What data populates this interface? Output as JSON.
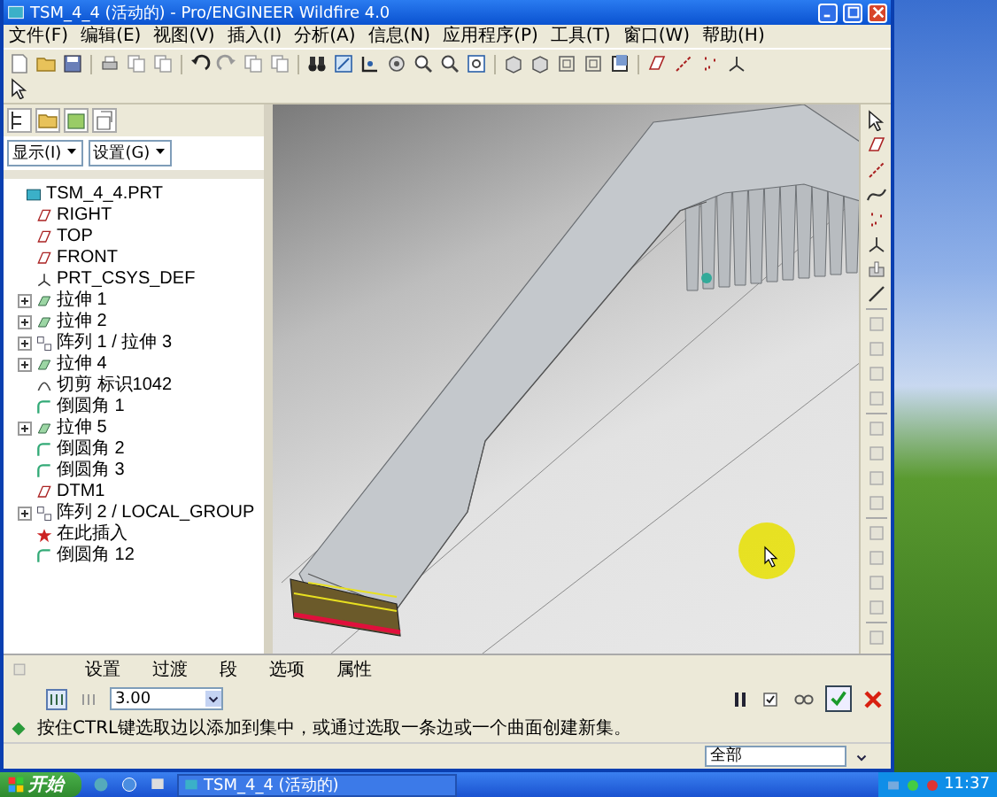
{
  "window": {
    "title": "TSM_4_4 (活动的) - Pro/ENGINEER Wildfire 4.0"
  },
  "menu": [
    "文件(F)",
    "编辑(E)",
    "视图(V)",
    "插入(I)",
    "分析(A)",
    "信息(N)",
    "应用程序(P)",
    "工具(T)",
    "窗口(W)",
    "帮助(H)"
  ],
  "navigator": {
    "dropdowns": [
      "显示(I)",
      "设置(G)"
    ]
  },
  "model_tree": {
    "label": "TSM_4_4.PRT",
    "kind": "part",
    "collapsed": false,
    "children": [
      {
        "label": "RIGHT",
        "kind": "plane",
        "collapsed": false
      },
      {
        "label": "TOP",
        "kind": "plane",
        "collapsed": false
      },
      {
        "label": "FRONT",
        "kind": "plane",
        "collapsed": false
      },
      {
        "label": "PRT_CSYS_DEF",
        "kind": "csys",
        "collapsed": false
      },
      {
        "label": "拉伸 1",
        "kind": "extrude",
        "collapsed": true
      },
      {
        "label": "拉伸 2",
        "kind": "extrude",
        "collapsed": true
      },
      {
        "label": "阵列 1 / 拉伸 3",
        "kind": "pattern",
        "collapsed": true
      },
      {
        "label": "拉伸 4",
        "kind": "extrude",
        "collapsed": true
      },
      {
        "label": "切剪 标识1042",
        "kind": "cut",
        "collapsed": false
      },
      {
        "label": "倒圆角 1",
        "kind": "round",
        "collapsed": false
      },
      {
        "label": "拉伸 5",
        "kind": "extrude",
        "collapsed": true
      },
      {
        "label": "倒圆角 2",
        "kind": "round",
        "collapsed": false
      },
      {
        "label": "倒圆角 3",
        "kind": "round",
        "collapsed": false
      },
      {
        "label": "DTM1",
        "kind": "plane",
        "collapsed": false
      },
      {
        "label": "阵列 2 / LOCAL_GROUP",
        "kind": "pattern",
        "collapsed": true
      },
      {
        "label": "在此插入",
        "kind": "insert",
        "collapsed": false
      },
      {
        "label": "倒圆角 12",
        "kind": "round",
        "collapsed": false
      }
    ]
  },
  "dashboard": {
    "tabs": [
      "设置",
      "过渡",
      "段",
      "选项",
      "属性"
    ],
    "radius": {
      "value": "3.00"
    },
    "message": "按住CTRL键选取边以添加到集中，或通过选取一条边或一个曲面创建新集。"
  },
  "status_bar": {
    "filter": "全部"
  },
  "taskbar": {
    "start": "开始",
    "task": "TSM_4_4 (活动的)",
    "clock": "11:37"
  }
}
